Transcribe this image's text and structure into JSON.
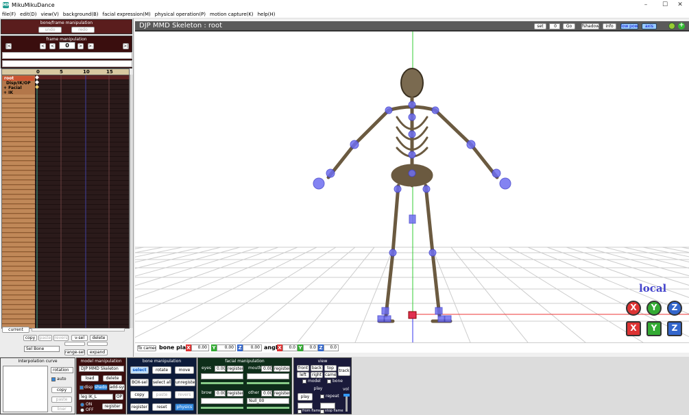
{
  "window": {
    "title": "MikuMikuDance",
    "app_icon": "MMD",
    "minimize": "–",
    "maximize": "☐",
    "close": "✕"
  },
  "menu": [
    "file(F)",
    "edit(D)",
    "view(V)",
    "background(B)",
    "facial expression(M)",
    "physical operation(P)",
    "motion capture(K)",
    "help(H)"
  ],
  "bone_frame": {
    "title": "bone/frame manipulation",
    "undo": "undo",
    "redo": "redo"
  },
  "frame_manip": {
    "title": "frame manipulation",
    "frame": "0",
    "first": "|<",
    "prev_key": "<",
    "prev": "<",
    "next": ">",
    "next_key": ">.",
    "last": ">|"
  },
  "timeline": {
    "ticks": [
      "0",
      "5",
      "10",
      "15"
    ],
    "rows": [
      "root",
      "Disp/IK/OP",
      "+ Facial",
      "+ IK"
    ]
  },
  "left_bottom": {
    "current": "current",
    "copy": "copy",
    "paste": "paste",
    "revers": "revers",
    "v_sel": "v-sel",
    "delete": "delete",
    "sel_bone": "Sel Bone",
    "range_sel": "range-sel",
    "expand": "expand"
  },
  "viewport": {
    "model_title": "DJP MMD Skeleton : root",
    "set": "set",
    "frame_value": "0",
    "go": "Go",
    "fshadow": "fshadow",
    "info": "info",
    "low_pow": "low pow",
    "axis": "axis",
    "local": "local",
    "to_camera": "To camera",
    "bone_place": "bone place",
    "x": "0.00",
    "y": "0.00",
    "z": "0.00",
    "angle": "angle",
    "ax": "0.0",
    "ay": "0.0",
    "az": "0.0"
  },
  "interp": {
    "title": "Interpolation curve",
    "select": "rotation",
    "auto": "auto",
    "copy": "copy",
    "paste": "paste",
    "liner": "liner"
  },
  "model": {
    "title": "model manipulation",
    "selected": "DJP MMD Skeleton",
    "load": "load",
    "delete": "delete",
    "disp": "disp",
    "shadow": "shadow",
    "add_synth": "add-syn",
    "ik": "leg IK_L",
    "op": "OP",
    "on": "ON",
    "off": "OFF",
    "register": "register"
  },
  "bone": {
    "title": "bone manipulation",
    "select": "select",
    "rotate": "rotate",
    "move": "move",
    "box_sel": "BOX-sel",
    "select_all": "select all",
    "unregisted": "unregisted",
    "copy": "copy",
    "paste": "paste",
    "revers": "revers",
    "register": "register",
    "reset": "reset",
    "physics": "physics"
  },
  "facial": {
    "title": "facial manipulation",
    "eyes": "eyes",
    "eyes_val": "0.000",
    "mouth": "mouth",
    "mouth_val": "0.000",
    "brow": "brow",
    "brow_val": "0.000",
    "other": "other",
    "other_val": "0.000",
    "other_sel": "Null_00",
    "register": "register"
  },
  "view": {
    "title": "view",
    "front": "front",
    "back": "back",
    "top": "top",
    "track": "track",
    "left": "left",
    "right": "right",
    "camera": "camer",
    "model": "model",
    "bone": "bone"
  },
  "play": {
    "title": "play",
    "play": "play",
    "repeat": "repeat",
    "from_frame": "from flame",
    "stop_frame": "stop flame",
    "vol": "vol"
  }
}
